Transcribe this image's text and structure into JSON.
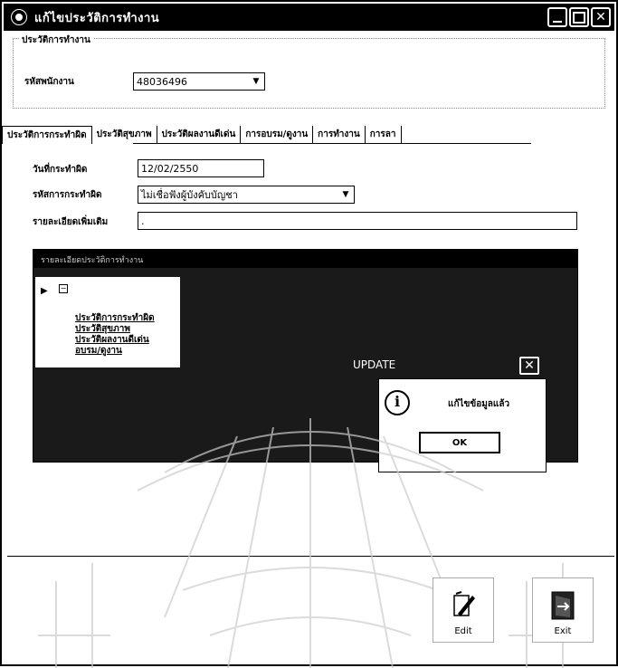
{
  "window": {
    "title": "แก้ไขประวัติการทำงาน",
    "controls": {
      "minimize": "minimize",
      "maximize": "maximize",
      "close": "✕"
    }
  },
  "work_history_group": {
    "legend": "ประวัติการทำงาน",
    "employee_id_label": "รหัสพนักงาน",
    "employee_id_value": "48036496"
  },
  "tabs": [
    {
      "label": "ประวัติการกระทำผิด",
      "active": true
    },
    {
      "label": "ประวัติสุขภาพ",
      "active": false
    },
    {
      "label": "ประวัติผลงานดีเด่น",
      "active": false
    },
    {
      "label": "การอบรม/ดูงาน",
      "active": false
    },
    {
      "label": "การทำงาน",
      "active": false
    },
    {
      "label": "การลา",
      "active": false
    }
  ],
  "offense_form": {
    "date_label": "วันที่กระทำผิด",
    "date_value": "12/02/2550",
    "code_label": "รหัสการกระทำผิด",
    "code_value": "ไม่เชื่อฟังผู้บังคับบัญชา",
    "detail_label": "รายละเอียดเพิ่มเติม",
    "detail_value": "."
  },
  "detail_panel": {
    "header": "รายละเอียดประวัติการทำงาน",
    "tree_items": [
      "ประวัติการกระทำผิด",
      "ประวัติสุขภาพ",
      "ประวัติผลงานดีเด่น",
      "อบรม/ดูงาน"
    ]
  },
  "message_box": {
    "title": "UPDATE",
    "close": "✕",
    "text": "แก้ไขข้อมูลแล้ว",
    "ok_label": "OK"
  },
  "buttons": {
    "edit_label": "Edit",
    "exit_label": "Exit"
  },
  "colors": {
    "titlebar": "#000000",
    "panel_dark": "#1a1a1a"
  }
}
